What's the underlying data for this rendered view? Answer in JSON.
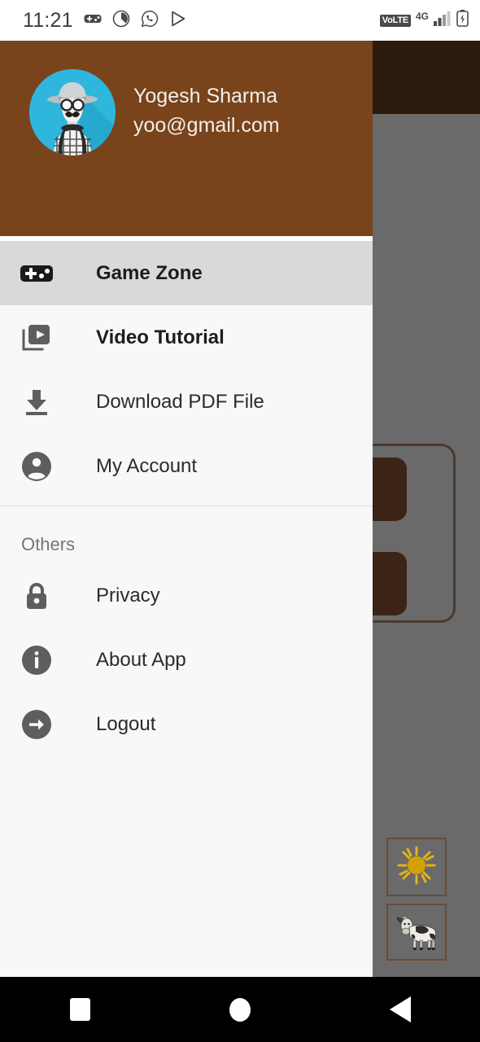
{
  "status_bar": {
    "time": "11:21",
    "left_icons": [
      "gamepad-icon",
      "circle-target-icon",
      "whatsapp-icon",
      "play-store-icon"
    ],
    "volte_label": "VoLTE",
    "network_label": "4G",
    "right_icons": [
      "signal-bars-icon",
      "battery-charging-icon"
    ]
  },
  "drawer": {
    "profile": {
      "name": "Yogesh Sharma",
      "email": "yoo@gmail.com",
      "avatar_icon": "hipster-avatar",
      "header_color": "#79431C"
    },
    "primary_items": [
      {
        "label": "Game Zone",
        "icon": "gamepad-icon",
        "selected": true,
        "bold": true
      },
      {
        "label": "Video Tutorial",
        "icon": "video-library-icon",
        "selected": false,
        "bold": true
      },
      {
        "label": "Download PDF File",
        "icon": "download-icon",
        "selected": false,
        "bold": false
      },
      {
        "label": "My Account",
        "icon": "account-circle-icon",
        "selected": false,
        "bold": false
      }
    ],
    "section_title": "Others",
    "secondary_items": [
      {
        "label": "Privacy",
        "icon": "lock-icon"
      },
      {
        "label": "About App",
        "icon": "info-circle-icon"
      },
      {
        "label": "Logout",
        "icon": "logout-arrow-icon"
      }
    ],
    "selected_background": "#D9D9D9",
    "background": "#F8F8F8"
  },
  "background_app": {
    "app_bar_color": "#2B1A0D",
    "scrim_color": "#6A6A6A",
    "tiles": [
      {
        "icon": "sun-icon"
      },
      {
        "icon": "cow-icon"
      }
    ]
  },
  "nav_bar": {
    "buttons": [
      {
        "icon": "recents-square-icon"
      },
      {
        "icon": "home-circle-icon"
      },
      {
        "icon": "back-triangle-icon"
      }
    ]
  }
}
